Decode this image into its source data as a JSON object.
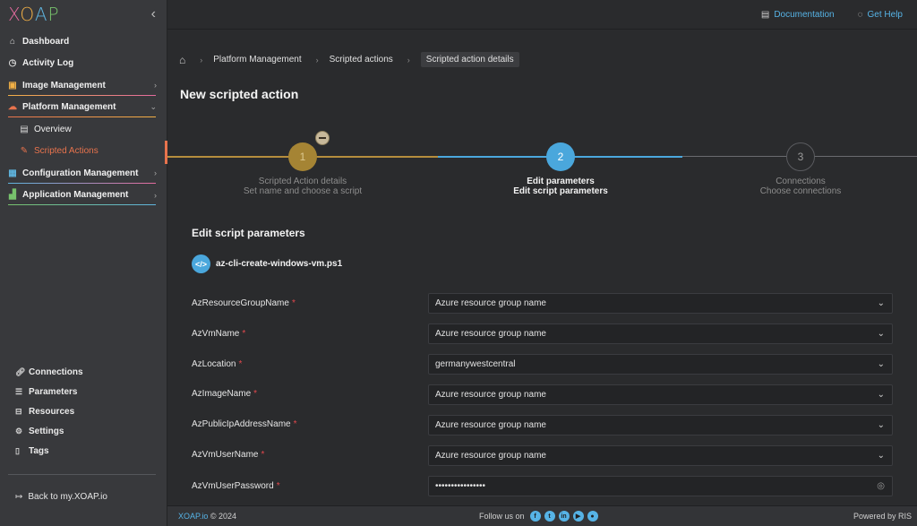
{
  "sidebar": {
    "logo": [
      "X",
      "O",
      "A",
      "P"
    ],
    "collapse_icon": "chevron-left-icon",
    "items": [
      {
        "label": "Dashboard",
        "icon": "home-icon"
      },
      {
        "label": "Activity Log",
        "icon": "clock-icon"
      },
      {
        "label": "Image Management",
        "icon": "images-icon",
        "underline": [
          "#f2b046",
          "#e46b9e"
        ]
      },
      {
        "label": "Platform Management",
        "icon": "cloud-icon",
        "underline": [
          "#e8734d",
          "#f2b046"
        ],
        "expanded": true
      },
      {
        "label": "Overview",
        "icon": "table-icon"
      },
      {
        "label": "Scripted Actions",
        "icon": "pencil-icon",
        "active": true
      },
      {
        "label": "Configuration Management",
        "icon": "config-icon",
        "underline": [
          "#5fb4de",
          "#e46b9e"
        ]
      },
      {
        "label": "Application Management",
        "icon": "apps-icon",
        "underline": [
          "#77c26c",
          "#5fb4de"
        ]
      }
    ],
    "bottom": [
      {
        "label": "Connections",
        "icon": "link-icon"
      },
      {
        "label": "Parameters",
        "icon": "list-icon"
      },
      {
        "label": "Resources",
        "icon": "resources-icon"
      },
      {
        "label": "Settings",
        "icon": "gear-icon"
      },
      {
        "label": "Tags",
        "icon": "bookmark-icon"
      }
    ],
    "back_label": "Back to my.XOAP.io"
  },
  "topbar": {
    "documentation": "Documentation",
    "help": "Get Help"
  },
  "breadcrumb": [
    "Platform Management",
    "Scripted actions",
    "Scripted action details"
  ],
  "page_title": "New scripted action",
  "steps": [
    {
      "number": "1",
      "title": "Scripted Action details",
      "subtitle": "Set name and choose a script",
      "state": "done"
    },
    {
      "number": "2",
      "title": "Edit parameters",
      "subtitle": "Edit script parameters",
      "state": "active"
    },
    {
      "number": "3",
      "title": "Connections",
      "subtitle": "Choose connections",
      "state": "pending"
    }
  ],
  "form": {
    "section_title": "Edit script parameters",
    "script_name": "az-cli-create-windows-vm.ps1",
    "fields": [
      {
        "label": "AzResourceGroupName",
        "value": "Azure resource group name",
        "type": "select"
      },
      {
        "label": "AzVmName",
        "value": "Azure resource group name",
        "type": "select"
      },
      {
        "label": "AzLocation",
        "value": "germanywestcentral",
        "type": "select"
      },
      {
        "label": "AzImageName",
        "value": "Azure resource group name",
        "type": "select"
      },
      {
        "label": "AzPublicIpAddressName",
        "value": "Azure resource group name",
        "type": "select"
      },
      {
        "label": "AzVmUserName",
        "value": "Azure resource group name",
        "type": "select"
      },
      {
        "label": "AzVmUserPassword",
        "value": "••••••••••••••••",
        "type": "password"
      }
    ],
    "required_mark": "*"
  },
  "footer": {
    "brand": "XOAP.io",
    "copyright": "© 2024",
    "follow": "Follow us on",
    "social": [
      "facebook-icon",
      "twitter-icon",
      "linkedin-icon",
      "youtube-icon",
      "github-icon"
    ],
    "powered": "Powered by RIS"
  },
  "colors": {
    "accent_blue": "#4aa7dc",
    "done_gold": "#c9a24a",
    "active_orange": "#e8734d",
    "required_red": "#e3484d"
  }
}
